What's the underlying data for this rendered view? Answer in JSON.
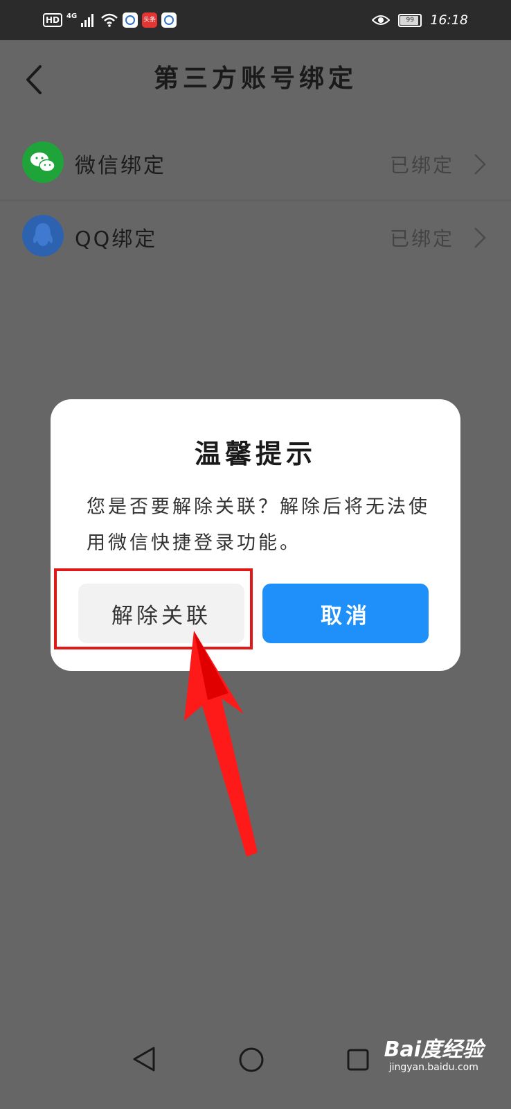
{
  "status_bar": {
    "hd_label": "HD",
    "network_label": "4G",
    "toutiao_label": "头条",
    "battery_level": "99",
    "time": "16:18"
  },
  "nav": {
    "title": "第三方账号绑定"
  },
  "accounts": [
    {
      "label": "微信绑定",
      "status": "已绑定",
      "icon": "wechat-icon",
      "color": "#1fa43a"
    },
    {
      "label": "QQ绑定",
      "status": "已绑定",
      "icon": "qq-icon",
      "color": "#2c62b0"
    }
  ],
  "dialog": {
    "title": "温馨提示",
    "message": "您是否要解除关联？解除后将无法使用微信快捷登录功能。",
    "unlink_label": "解除关联",
    "cancel_label": "取消"
  },
  "watermark": {
    "brand": "Bai度经验",
    "url": "jingyan.baidu.com"
  },
  "colors": {
    "overlay_bg": "#666666",
    "primary_button": "#1f8ff9",
    "highlight": "#e01818"
  }
}
